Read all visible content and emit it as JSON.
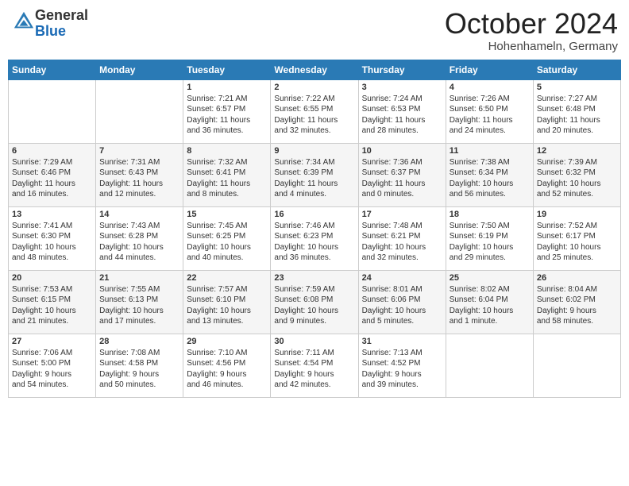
{
  "header": {
    "logo_general": "General",
    "logo_blue": "Blue",
    "month": "October 2024",
    "location": "Hohenhameln, Germany"
  },
  "days_of_week": [
    "Sunday",
    "Monday",
    "Tuesday",
    "Wednesday",
    "Thursday",
    "Friday",
    "Saturday"
  ],
  "weeks": [
    [
      {
        "day": "",
        "detail": ""
      },
      {
        "day": "",
        "detail": ""
      },
      {
        "day": "1",
        "detail": "Sunrise: 7:21 AM\nSunset: 6:57 PM\nDaylight: 11 hours\nand 36 minutes."
      },
      {
        "day": "2",
        "detail": "Sunrise: 7:22 AM\nSunset: 6:55 PM\nDaylight: 11 hours\nand 32 minutes."
      },
      {
        "day": "3",
        "detail": "Sunrise: 7:24 AM\nSunset: 6:53 PM\nDaylight: 11 hours\nand 28 minutes."
      },
      {
        "day": "4",
        "detail": "Sunrise: 7:26 AM\nSunset: 6:50 PM\nDaylight: 11 hours\nand 24 minutes."
      },
      {
        "day": "5",
        "detail": "Sunrise: 7:27 AM\nSunset: 6:48 PM\nDaylight: 11 hours\nand 20 minutes."
      }
    ],
    [
      {
        "day": "6",
        "detail": "Sunrise: 7:29 AM\nSunset: 6:46 PM\nDaylight: 11 hours\nand 16 minutes."
      },
      {
        "day": "7",
        "detail": "Sunrise: 7:31 AM\nSunset: 6:43 PM\nDaylight: 11 hours\nand 12 minutes."
      },
      {
        "day": "8",
        "detail": "Sunrise: 7:32 AM\nSunset: 6:41 PM\nDaylight: 11 hours\nand 8 minutes."
      },
      {
        "day": "9",
        "detail": "Sunrise: 7:34 AM\nSunset: 6:39 PM\nDaylight: 11 hours\nand 4 minutes."
      },
      {
        "day": "10",
        "detail": "Sunrise: 7:36 AM\nSunset: 6:37 PM\nDaylight: 11 hours\nand 0 minutes."
      },
      {
        "day": "11",
        "detail": "Sunrise: 7:38 AM\nSunset: 6:34 PM\nDaylight: 10 hours\nand 56 minutes."
      },
      {
        "day": "12",
        "detail": "Sunrise: 7:39 AM\nSunset: 6:32 PM\nDaylight: 10 hours\nand 52 minutes."
      }
    ],
    [
      {
        "day": "13",
        "detail": "Sunrise: 7:41 AM\nSunset: 6:30 PM\nDaylight: 10 hours\nand 48 minutes."
      },
      {
        "day": "14",
        "detail": "Sunrise: 7:43 AM\nSunset: 6:28 PM\nDaylight: 10 hours\nand 44 minutes."
      },
      {
        "day": "15",
        "detail": "Sunrise: 7:45 AM\nSunset: 6:25 PM\nDaylight: 10 hours\nand 40 minutes."
      },
      {
        "day": "16",
        "detail": "Sunrise: 7:46 AM\nSunset: 6:23 PM\nDaylight: 10 hours\nand 36 minutes."
      },
      {
        "day": "17",
        "detail": "Sunrise: 7:48 AM\nSunset: 6:21 PM\nDaylight: 10 hours\nand 32 minutes."
      },
      {
        "day": "18",
        "detail": "Sunrise: 7:50 AM\nSunset: 6:19 PM\nDaylight: 10 hours\nand 29 minutes."
      },
      {
        "day": "19",
        "detail": "Sunrise: 7:52 AM\nSunset: 6:17 PM\nDaylight: 10 hours\nand 25 minutes."
      }
    ],
    [
      {
        "day": "20",
        "detail": "Sunrise: 7:53 AM\nSunset: 6:15 PM\nDaylight: 10 hours\nand 21 minutes."
      },
      {
        "day": "21",
        "detail": "Sunrise: 7:55 AM\nSunset: 6:13 PM\nDaylight: 10 hours\nand 17 minutes."
      },
      {
        "day": "22",
        "detail": "Sunrise: 7:57 AM\nSunset: 6:10 PM\nDaylight: 10 hours\nand 13 minutes."
      },
      {
        "day": "23",
        "detail": "Sunrise: 7:59 AM\nSunset: 6:08 PM\nDaylight: 10 hours\nand 9 minutes."
      },
      {
        "day": "24",
        "detail": "Sunrise: 8:01 AM\nSunset: 6:06 PM\nDaylight: 10 hours\nand 5 minutes."
      },
      {
        "day": "25",
        "detail": "Sunrise: 8:02 AM\nSunset: 6:04 PM\nDaylight: 10 hours\nand 1 minute."
      },
      {
        "day": "26",
        "detail": "Sunrise: 8:04 AM\nSunset: 6:02 PM\nDaylight: 9 hours\nand 58 minutes."
      }
    ],
    [
      {
        "day": "27",
        "detail": "Sunrise: 7:06 AM\nSunset: 5:00 PM\nDaylight: 9 hours\nand 54 minutes."
      },
      {
        "day": "28",
        "detail": "Sunrise: 7:08 AM\nSunset: 4:58 PM\nDaylight: 9 hours\nand 50 minutes."
      },
      {
        "day": "29",
        "detail": "Sunrise: 7:10 AM\nSunset: 4:56 PM\nDaylight: 9 hours\nand 46 minutes."
      },
      {
        "day": "30",
        "detail": "Sunrise: 7:11 AM\nSunset: 4:54 PM\nDaylight: 9 hours\nand 42 minutes."
      },
      {
        "day": "31",
        "detail": "Sunrise: 7:13 AM\nSunset: 4:52 PM\nDaylight: 9 hours\nand 39 minutes."
      },
      {
        "day": "",
        "detail": ""
      },
      {
        "day": "",
        "detail": ""
      }
    ]
  ]
}
